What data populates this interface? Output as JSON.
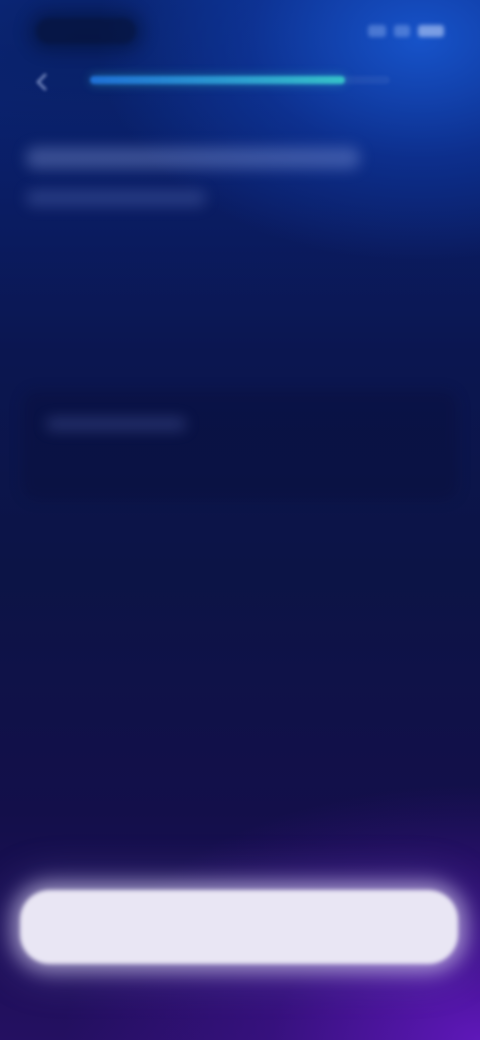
{
  "status_bar": {
    "time": "",
    "icons": [
      "signal-icon",
      "wifi-icon",
      "battery-icon"
    ]
  },
  "top_bar": {
    "back_icon": "back-arrow-icon",
    "progress": 0.85,
    "progress_color": "#36c3c9"
  },
  "header": {
    "title": "",
    "subtitle": ""
  },
  "content": {
    "option_label": ""
  },
  "footer": {
    "primary_button_label": ""
  },
  "colors": {
    "background_top": "#0c2a82",
    "background_bottom": "#241061",
    "button_fill": "#e9e6f4"
  }
}
